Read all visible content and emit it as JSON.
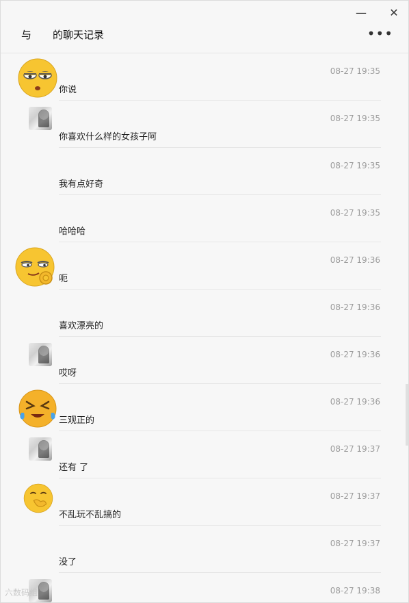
{
  "window": {
    "title_prefix": "与",
    "title_suffix": "的聊天记录",
    "more_glyph": "•••",
    "minimize_glyph": "—",
    "close_glyph": "✕"
  },
  "messages": [
    {
      "time": "08-27 19:35",
      "text": "你说",
      "avatar": "eye-roll-emoji"
    },
    {
      "time": "08-27 19:35",
      "text": "你喜欢什么样的女孩子阿",
      "avatar": "photo"
    },
    {
      "time": "08-27 19:35",
      "text": "我有点好奇",
      "avatar": "none"
    },
    {
      "time": "08-27 19:35",
      "text": "哈哈哈",
      "avatar": "none"
    },
    {
      "time": "08-27 19:36",
      "text": "呃",
      "avatar": "smirk-ok-emoji"
    },
    {
      "time": "08-27 19:36",
      "text": "喜欢漂亮的",
      "avatar": "none"
    },
    {
      "time": "08-27 19:36",
      "text": "哎呀",
      "avatar": "photo"
    },
    {
      "time": "08-27 19:36",
      "text": "三观正的",
      "avatar": "laugh-cry-emoji"
    },
    {
      "time": "08-27 19:37",
      "text": "还有 了",
      "avatar": "photo"
    },
    {
      "time": "08-27 19:37",
      "text": "不乱玩不乱搞的",
      "avatar": "thinking-emoji"
    },
    {
      "time": "08-27 19:37",
      "text": "没了",
      "avatar": "none"
    },
    {
      "time": "08-27 19:38",
      "text": "",
      "avatar": "photo"
    }
  ],
  "watermark": "六数码组"
}
